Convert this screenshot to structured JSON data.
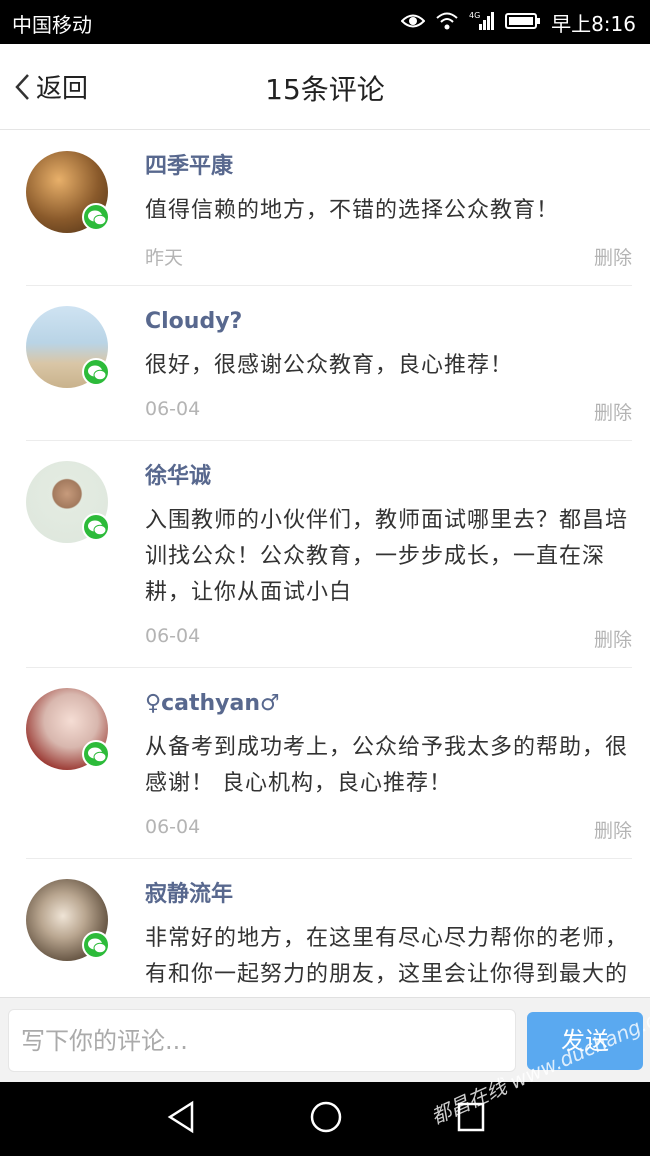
{
  "status_bar": {
    "carrier": "中国移动",
    "time": "早上8:16",
    "network": "4G"
  },
  "nav": {
    "back_label": "返回",
    "title": "15条评论"
  },
  "comments": [
    {
      "name": "四季平康",
      "text": "值得信赖的地方，不错的选择公众教育！",
      "date": "昨天",
      "delete_label": "删除",
      "avatar_color": "#8a5a2b"
    },
    {
      "name": "Cloudy?",
      "text": "很好，很感谢公众教育，良心推荐！",
      "date": "06-04",
      "delete_label": "删除",
      "avatar_color": "#b9d4e6"
    },
    {
      "name": "徐华诚",
      "text": "入围教师的小伙伴们，教师面试哪里去？都昌培训找公众！公众教育，一步步成长，一直在深耕，让你从面试小白",
      "date": "06-04",
      "delete_label": "删除",
      "avatar_color": "#dde6dc"
    },
    {
      "name": "♀cathyan♂",
      "text": "从备考到成功考上，公众给予我太多的帮助，很感谢！ 良心机构，良心推荐！",
      "date": "06-04",
      "delete_label": "删除",
      "avatar_color": "#d8b7ae"
    },
    {
      "name": "寂静流年",
      "text": "非常好的地方，在这里有尽心尽力帮你的老师，有和你一起努力的朋友，这里会让你得到最大的进步",
      "date": "",
      "delete_label": "",
      "avatar_color": "#6b5a48"
    }
  ],
  "input": {
    "placeholder": "写下你的评论...",
    "send_label": "发送"
  },
  "watermark": "都昌在线 www.duchang.org",
  "colors": {
    "name": "#58688e",
    "meta": "#b4b4b4",
    "send_button": "#5aa9f0",
    "wechat": "#2dbb3a"
  }
}
